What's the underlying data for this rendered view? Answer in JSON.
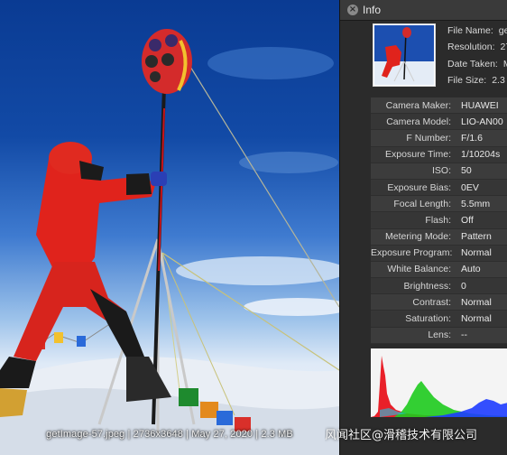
{
  "viewer": {
    "caption": "getImage-57.jpeg | 2736x3648 | May 27, 2020 | 2.3 MB"
  },
  "info_panel": {
    "title": "Info",
    "file_summary": [
      {
        "label": "File Name:",
        "value": "ge"
      },
      {
        "label": "Resolution:",
        "value": "27"
      },
      {
        "label": "Date Taken:",
        "value": "M"
      },
      {
        "label": "File Size:",
        "value": "2.3"
      }
    ],
    "exif": [
      {
        "label": "Camera Maker:",
        "value": "HUAWEI"
      },
      {
        "label": "Camera Model:",
        "value": "LIO-AN00"
      },
      {
        "label": "F Number:",
        "value": "F/1.6"
      },
      {
        "label": "Exposure Time:",
        "value": "1/10204s"
      },
      {
        "label": "ISO:",
        "value": "50"
      },
      {
        "label": "Exposure Bias:",
        "value": "0EV"
      },
      {
        "label": "Focal Length:",
        "value": "5.5mm"
      },
      {
        "label": "Flash:",
        "value": "Off"
      },
      {
        "label": "Metering Mode:",
        "value": "Pattern"
      },
      {
        "label": "Exposure Program:",
        "value": "Normal"
      },
      {
        "label": "White Balance:",
        "value": "Auto"
      },
      {
        "label": "Brightness:",
        "value": "0"
      },
      {
        "label": "Contrast:",
        "value": "Normal"
      },
      {
        "label": "Saturation:",
        "value": "Normal"
      },
      {
        "label": "Lens:",
        "value": "--"
      }
    ]
  },
  "watermark": "风闻社区@滑稽技术有限公司",
  "colors": {
    "panel_bg": "#2b2b2b",
    "sky_top": "#0a3b93",
    "histogram_red": "#e8141e",
    "histogram_green": "#1ecb1e",
    "histogram_blue": "#1e3cff"
  }
}
